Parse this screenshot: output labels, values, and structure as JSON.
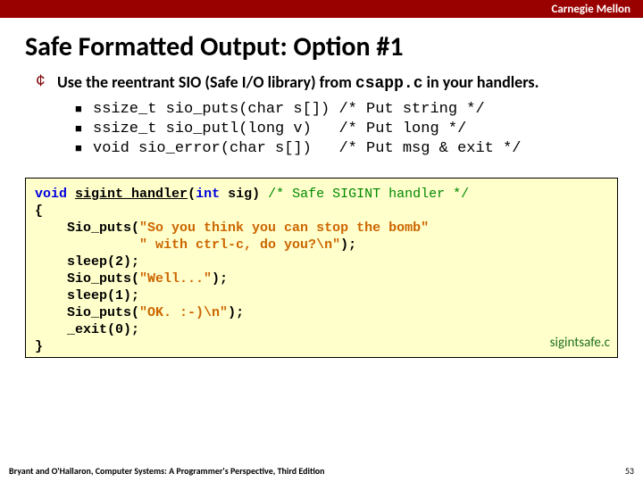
{
  "header": {
    "brand": "Carnegie Mellon"
  },
  "title": "Safe Formatted Output: Option #1",
  "main_bullet": {
    "pre": "Use the reentrant SIO (Safe I/O library) from ",
    "code": "csapp.c",
    "post": " in your handlers."
  },
  "sigs": [
    "ssize_t sio_puts(char s[]) /* Put string */",
    "ssize_t sio_putl(long v)   /* Put long */",
    "void sio_error(char s[])   /* Put msg & exit */"
  ],
  "code": {
    "kw_void": "void",
    "fn_name": "sigint_handler",
    "kw_int": "int",
    "arg": " sig)",
    "cmt": " /* Safe SIGINT handler */",
    "lines": {
      "open": "{",
      "l1a": "    Sio_puts(",
      "l1s": "\"So you think you can stop the bomb\"",
      "l2pad": "             ",
      "l2s": "\" with ctrl-c, do you?\\n\"",
      "l2end": ");",
      "l3": "    sleep(2);",
      "l4a": "    Sio_puts(",
      "l4s": "\"Well...\"",
      "l4end": ");",
      "l5": "    sleep(1);",
      "l6a": "    Sio_puts(",
      "l6s": "\"OK. :-)\\n\"",
      "l6end": ");",
      "l7": "    _exit(0);",
      "close": "}"
    },
    "label": "sigintsafe.c"
  },
  "footer": {
    "left": "Bryant and O'Hallaron, Computer Systems: A Programmer's Perspective, Third Edition",
    "page": "53"
  }
}
